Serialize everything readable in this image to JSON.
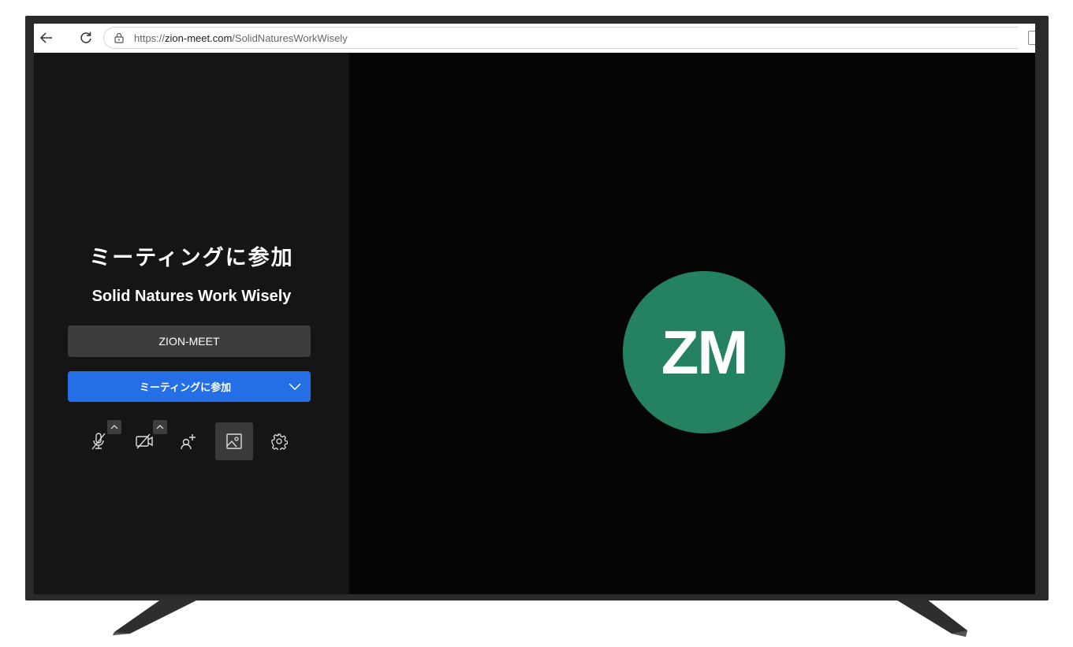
{
  "browser": {
    "url_scheme": "https://",
    "url_domain": "zion-meet.com",
    "url_path": "/SolidNaturesWorkWisely"
  },
  "prejoin": {
    "heading": "ミーティングに参加",
    "meeting_name": "Solid Natures Work Wisely",
    "display_name_value": "ZION-MEET",
    "join_button_label": "ミーティングに参加"
  },
  "toolbar": {
    "icons": [
      "microphone-muted-icon",
      "camera-off-icon",
      "invite-people-icon",
      "background-image-icon",
      "settings-icon"
    ]
  },
  "preview": {
    "avatar_initials": "ZM",
    "avatar_color": "#258261"
  },
  "colors": {
    "accent": "#246fe5",
    "panel": "#151515",
    "stage": "#050505"
  }
}
